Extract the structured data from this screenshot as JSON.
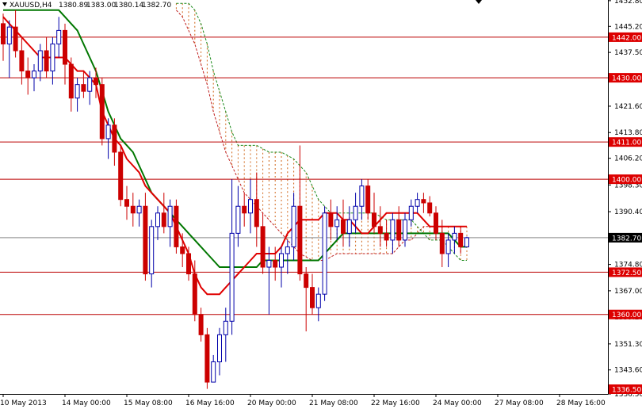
{
  "chart_data": {
    "type": "candlestick",
    "symbol": "XAUUSD,H4",
    "ohlc_readout": [
      "1380.89",
      "1383.00",
      "1380.14",
      "1382.70"
    ],
    "y_range": [
      1336.5,
      1453.0
    ],
    "y_ticks": [
      "1452.80",
      "1445.20",
      "1437.50",
      "1429.90",
      "1421.60",
      "1413.80",
      "1406.20",
      "1398.30",
      "1390.40",
      "1382.70",
      "1374.80",
      "1367.00",
      "1359.20",
      "1351.30",
      "1343.60",
      "1336.50"
    ],
    "y_tick_values": [
      1452.8,
      1445.2,
      1437.5,
      1429.9,
      1421.6,
      1413.8,
      1406.2,
      1398.3,
      1390.4,
      1382.7,
      1374.8,
      1367.0,
      1359.2,
      1351.3,
      1343.6,
      1336.5
    ],
    "horizontal_levels": [
      {
        "value": 1442.0,
        "label": "1442.00"
      },
      {
        "value": 1430.0,
        "label": "1430.00"
      },
      {
        "value": 1411.0,
        "label": "1411.00"
      },
      {
        "value": 1400.0,
        "label": "1400.00"
      },
      {
        "value": 1372.5,
        "label": "1372.50"
      },
      {
        "value": 1360.0,
        "label": "1360.00"
      }
    ],
    "current_price": {
      "value": 1382.7,
      "label": "1382.70"
    },
    "x_labels": [
      {
        "bar": 0,
        "text": "10 May 2013"
      },
      {
        "bar": 10,
        "text": "14 May 00:00"
      },
      {
        "bar": 20,
        "text": "15 May 08:00"
      },
      {
        "bar": 30,
        "text": "16 May 16:00"
      },
      {
        "bar": 40,
        "text": "20 May 00:00"
      },
      {
        "bar": 50,
        "text": "21 May 08:00"
      },
      {
        "bar": 60,
        "text": "22 May 16:00"
      },
      {
        "bar": 70,
        "text": "24 May 00:00"
      },
      {
        "bar": 80,
        "text": "27 May 08:00"
      },
      {
        "bar": 90,
        "text": "28 May 16:00"
      }
    ],
    "bars": [
      [
        1446,
        1449,
        1435,
        1440
      ],
      [
        1440,
        1447,
        1430,
        1445
      ],
      [
        1445,
        1450,
        1436,
        1438
      ],
      [
        1438,
        1442,
        1428,
        1432
      ],
      [
        1432,
        1436,
        1425,
        1430
      ],
      [
        1430,
        1434,
        1426,
        1432
      ],
      [
        1432,
        1440,
        1429,
        1438
      ],
      [
        1438,
        1442,
        1430,
        1432
      ],
      [
        1432,
        1442,
        1428,
        1440
      ],
      [
        1440,
        1448,
        1436,
        1444
      ],
      [
        1444,
        1446,
        1428,
        1434
      ],
      [
        1434,
        1436,
        1420,
        1424
      ],
      [
        1424,
        1430,
        1420,
        1428
      ],
      [
        1428,
        1432,
        1424,
        1426
      ],
      [
        1426,
        1432,
        1422,
        1430
      ],
      [
        1430,
        1433,
        1424,
        1428
      ],
      [
        1428,
        1430,
        1410,
        1412
      ],
      [
        1412,
        1418,
        1406,
        1416
      ],
      [
        1416,
        1418,
        1404,
        1408
      ],
      [
        1408,
        1410,
        1392,
        1394
      ],
      [
        1394,
        1398,
        1388,
        1392
      ],
      [
        1392,
        1396,
        1386,
        1390
      ],
      [
        1390,
        1394,
        1386,
        1392
      ],
      [
        1392,
        1396,
        1370,
        1372
      ],
      [
        1372,
        1388,
        1368,
        1386
      ],
      [
        1386,
        1392,
        1382,
        1390
      ],
      [
        1390,
        1396,
        1384,
        1386
      ],
      [
        1386,
        1394,
        1380,
        1392
      ],
      [
        1392,
        1394,
        1378,
        1380
      ],
      [
        1380,
        1384,
        1374,
        1378
      ],
      [
        1378,
        1380,
        1370,
        1372
      ],
      [
        1372,
        1376,
        1358,
        1360
      ],
      [
        1360,
        1362,
        1352,
        1354
      ],
      [
        1354,
        1356,
        1338,
        1340
      ],
      [
        1340,
        1348,
        1340,
        1346
      ],
      [
        1346,
        1356,
        1342,
        1354
      ],
      [
        1354,
        1362,
        1346,
        1358
      ],
      [
        1358,
        1400,
        1354,
        1384
      ],
      [
        1384,
        1398,
        1380,
        1392
      ],
      [
        1392,
        1396,
        1386,
        1390
      ],
      [
        1390,
        1400,
        1384,
        1394
      ],
      [
        1394,
        1402,
        1380,
        1386
      ],
      [
        1386,
        1390,
        1372,
        1374
      ],
      [
        1374,
        1380,
        1360,
        1376
      ],
      [
        1376,
        1380,
        1370,
        1374
      ],
      [
        1374,
        1380,
        1368,
        1378
      ],
      [
        1378,
        1382,
        1372,
        1380
      ],
      [
        1380,
        1396,
        1376,
        1392
      ],
      [
        1392,
        1410,
        1370,
        1372
      ],
      [
        1372,
        1374,
        1355,
        1368
      ],
      [
        1368,
        1372,
        1360,
        1362
      ],
      [
        1362,
        1368,
        1358,
        1366
      ],
      [
        1366,
        1392,
        1364,
        1390
      ],
      [
        1390,
        1394,
        1382,
        1386
      ],
      [
        1386,
        1392,
        1382,
        1388
      ],
      [
        1388,
        1394,
        1380,
        1384
      ],
      [
        1384,
        1392,
        1380,
        1388
      ],
      [
        1388,
        1396,
        1384,
        1392
      ],
      [
        1392,
        1400,
        1388,
        1398
      ],
      [
        1398,
        1400,
        1388,
        1390
      ],
      [
        1390,
        1396,
        1384,
        1386
      ],
      [
        1386,
        1392,
        1380,
        1384
      ],
      [
        1384,
        1388,
        1380,
        1382
      ],
      [
        1382,
        1390,
        1378,
        1388
      ],
      [
        1388,
        1392,
        1380,
        1382
      ],
      [
        1382,
        1390,
        1380,
        1388
      ],
      [
        1388,
        1394,
        1386,
        1392
      ],
      [
        1392,
        1396,
        1390,
        1394
      ],
      [
        1394,
        1396,
        1390,
        1393
      ],
      [
        1393,
        1395,
        1389,
        1390
      ],
      [
        1390,
        1392,
        1382,
        1384
      ],
      [
        1384,
        1388,
        1374,
        1378
      ],
      [
        1378,
        1384,
        1374,
        1382
      ],
      [
        1382,
        1386,
        1378,
        1384
      ],
      [
        1384,
        1386,
        1378,
        1380
      ],
      [
        1380,
        1383,
        1380,
        1382.7
      ]
    ],
    "tenkan": [
      1448,
      1446,
      1444,
      1442,
      1440,
      1438,
      1436,
      1436,
      1436,
      1436,
      1436,
      1434,
      1432,
      1432,
      1430,
      1428,
      1420,
      1416,
      1412,
      1410,
      1406,
      1404,
      1402,
      1398,
      1396,
      1394,
      1392,
      1390,
      1386,
      1382,
      1378,
      1372,
      1368,
      1366,
      1366,
      1366,
      1368,
      1370,
      1372,
      1374,
      1376,
      1378,
      1378,
      1378,
      1378,
      1380,
      1384,
      1386,
      1388,
      1388,
      1388,
      1388,
      1390,
      1390,
      1390,
      1388,
      1388,
      1386,
      1384,
      1384,
      1386,
      1388,
      1390,
      1390,
      1390,
      1390,
      1390,
      1390,
      1388,
      1386,
      1386,
      1386,
      1386,
      1386,
      1386,
      1386
    ],
    "kijun": [
      1450,
      1450,
      1450,
      1450,
      1450,
      1450,
      1450,
      1450,
      1450,
      1450,
      1448,
      1446,
      1444,
      1440,
      1436,
      1432,
      1426,
      1420,
      1416,
      1412,
      1410,
      1408,
      1404,
      1400,
      1396,
      1394,
      1392,
      1390,
      1388,
      1386,
      1384,
      1382,
      1380,
      1378,
      1376,
      1374,
      1374,
      1374,
      1374,
      1374,
      1374,
      1374,
      1376,
      1376,
      1376,
      1376,
      1376,
      1376,
      1376,
      1376,
      1376,
      1376,
      1378,
      1380,
      1382,
      1384,
      1384,
      1384,
      1384,
      1384,
      1384,
      1384,
      1384,
      1384,
      1384,
      1384,
      1384,
      1384,
      1384,
      1384,
      1384,
      1384,
      1384,
      1382,
      1380,
      1380
    ],
    "senkou_a": [
      1450,
      1448,
      1444,
      1440,
      1434,
      1428,
      1420,
      1414,
      1408,
      1404,
      1400,
      1396,
      1394,
      1392,
      1390,
      1388,
      1386,
      1384,
      1382,
      1380,
      1378,
      1377,
      1376,
      1376,
      1376,
      1377,
      1378,
      1378,
      1378,
      1378,
      1378,
      1378,
      1378,
      1378,
      1378,
      1378,
      1380,
      1382,
      1382,
      1384,
      1386,
      1386,
      1386,
      1386,
      1386,
      1386,
      1386,
      1386
    ],
    "senkou_b": [
      1452,
      1452,
      1452,
      1450,
      1446,
      1440,
      1432,
      1426,
      1420,
      1414,
      1410,
      1410,
      1410,
      1410,
      1409,
      1408,
      1408,
      1408,
      1407,
      1406,
      1404,
      1402,
      1398,
      1394,
      1392,
      1390,
      1390,
      1390,
      1390,
      1390,
      1390,
      1390,
      1390,
      1389,
      1388,
      1388,
      1388,
      1388,
      1388,
      1386,
      1384,
      1382,
      1382,
      1382,
      1380,
      1378,
      1376,
      1376
    ],
    "cloud_offset_bars": 28,
    "colors": {
      "bull": "#0000aa",
      "bear": "#cc0000",
      "tenkan": "#e00000",
      "kijun": "#007700",
      "level": "#bb0000",
      "cloud": "#cc5500",
      "label_bg": "#dd0000",
      "label_text": "#ffffff",
      "current_label_bg": "#000000",
      "axis": "#000000",
      "price_line": "#8a8a8a"
    }
  }
}
